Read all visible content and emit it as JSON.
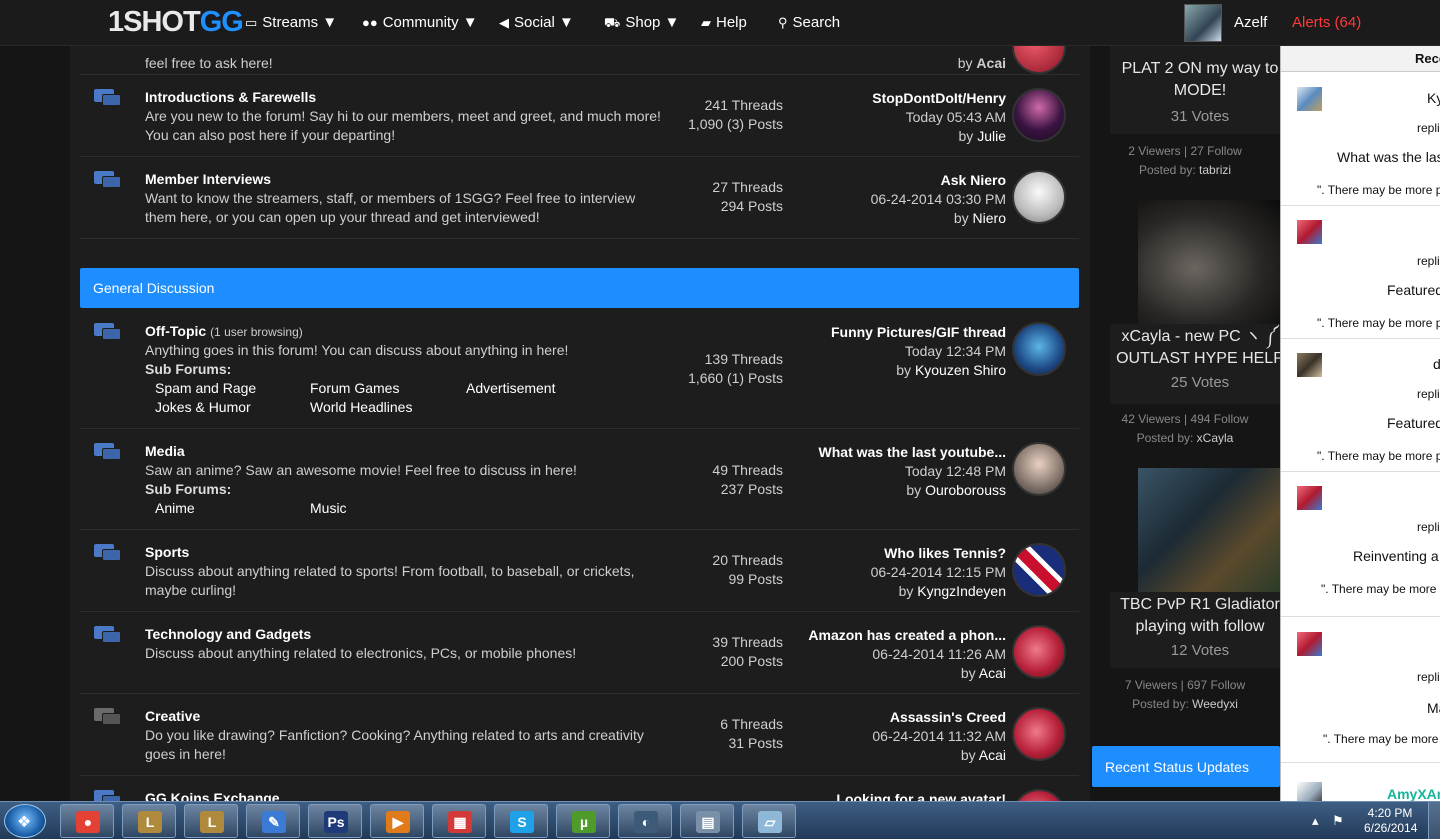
{
  "header": {
    "logo_part1": "1SHOT",
    "logo_part2": "GG",
    "nav": [
      {
        "icon": "monitor-icon",
        "label": "Streams ▼"
      },
      {
        "icon": "users-icon",
        "label": "Community ▼"
      },
      {
        "icon": "megaphone-icon",
        "label": "Social ▼"
      },
      {
        "icon": "cart-icon",
        "label": "Shop ▼"
      },
      {
        "icon": "book-icon",
        "label": "Help"
      },
      {
        "icon": "search-icon",
        "label": "Search"
      }
    ],
    "username": "Azelf",
    "alerts": "Alerts (64)"
  },
  "forums_top": [
    {
      "title": "",
      "desc": "feel free to ask here!",
      "last_by": "Acai"
    },
    {
      "title": "Introductions & Farewells",
      "desc": "Are you new to the forum! Say hi to our members, meet and greet, and much more! You can also post here if your departing!",
      "threads": "241 Threads",
      "posts": "1,090 (3) Posts",
      "last_title": "StopDontDoIt/Henry",
      "last_time": "Today 05:43 AM",
      "by_prefix": "by ",
      "last_by": "Julie"
    },
    {
      "title": "Member Interviews",
      "desc": "Want to know the streamers, staff, or members of 1SGG? Feel free to interview them here, or you can open up your thread and get interviewed!",
      "threads": "27 Threads",
      "posts": "294 Posts",
      "last_title": "Ask Niero",
      "last_time": "06-24-2014 03:30 PM",
      "by_prefix": "by ",
      "last_by": "Niero"
    }
  ],
  "category": "General Discussion",
  "forums": [
    {
      "title": "Off-Topic",
      "browsing": "(1 user browsing)",
      "desc": "Anything goes in this forum! You can discuss about anything in here!",
      "subforums_label": "Sub Forums:",
      "subforums": [
        "Spam and Rage",
        "Forum Games",
        "Advertisement",
        "Jokes & Humor",
        "World Headlines"
      ],
      "threads": "139 Threads",
      "posts": "1,660 (1) Posts",
      "last_title": "Funny Pictures/GIF thread",
      "last_time": "Today 12:34 PM",
      "by_prefix": "by ",
      "last_by": "Kyouzen Shiro"
    },
    {
      "title": "Media",
      "desc": "Saw an anime? Saw an awesome movie! Feel free to discuss in here!",
      "subforums_label": "Sub Forums:",
      "subforums": [
        "Anime",
        "Music"
      ],
      "threads": "49 Threads",
      "posts": "237 Posts",
      "last_title": "What was the last youtube...",
      "last_time": "Today 12:48 PM",
      "by_prefix": "by ",
      "last_by": "Ouroborouss"
    },
    {
      "title": "Sports",
      "desc": "Discuss about anything related to sports! From football, to baseball, or crickets, maybe curling!",
      "threads": "20 Threads",
      "posts": "99 Posts",
      "last_title": "Who likes Tennis?",
      "last_time": "06-24-2014 12:15 PM",
      "by_prefix": "by ",
      "last_by": "KyngzIndeyen"
    },
    {
      "title": "Technology and Gadgets",
      "desc": "Discuss about anything related to electronics, PCs, or mobile phones!",
      "threads": "39 Threads",
      "posts": "200 Posts",
      "last_title": "Amazon has created a phon...",
      "last_time": "06-24-2014 11:26 AM",
      "by_prefix": "by ",
      "last_by": "Acai"
    },
    {
      "title": "Creative",
      "desc": "Do you like drawing? Fanfiction? Cooking? Anything related to arts and creativity goes in here!",
      "threads": "6 Threads",
      "posts": "31 Posts",
      "last_title": "Assassin's Creed",
      "last_time": "06-24-2014 11:32 AM",
      "by_prefix": "by ",
      "last_by": "Acai"
    },
    {
      "title": "GG Koins Exchange",
      "last_title": "Looking for a new avatar!"
    }
  ],
  "streams": [
    {
      "title": "PLAT 2 ON my way to MODE!",
      "votes": "31 Votes",
      "meta": "2 Viewers | 27 Follow",
      "posted_by_label": "Posted by: ",
      "posted_by": "tabrizi"
    },
    {
      "title": "xCayla - new PC ヽ ༼ OUTLAST HYPE HELP ",
      "votes": "25 Votes",
      "meta": "42 Viewers | 494 Follow",
      "posted_by_label": "Posted by: ",
      "posted_by": "xCayla"
    },
    {
      "title": "TBC PvP R1 Gladiator playing with follow",
      "votes": "12 Votes",
      "meta": "7 Viewers | 697 Follow",
      "posted_by_label": "Posted by: ",
      "posted_by": "Weedyxi"
    }
  ],
  "recent_status": "Recent Status Updates",
  "alerts_panel": {
    "header": "Rece",
    "items": [
      {
        "name": "Ky",
        "action": "replie",
        "thread": "What was the las",
        "more": "\". There may be more pos"
      },
      {
        "name": "",
        "action": "replie",
        "thread": "Featured S",
        "more": "\". There may be more pos"
      },
      {
        "name": "d",
        "action": "replie",
        "thread": "Featured S",
        "more": "\". There may be more pos"
      },
      {
        "name": "",
        "action": "replie",
        "thread": "Reinventing a",
        "more": "\". There may be more pos"
      },
      {
        "name": "",
        "action": "replie",
        "thread": "Ma",
        "more": "\". There may be more pos"
      },
      {
        "name": "AmyXAn",
        "action": "",
        "thread": "",
        "more": ""
      }
    ]
  },
  "taskbar": {
    "time": "4:20 PM",
    "date": "6/26/2014",
    "apps": [
      {
        "icon": "chrome-icon",
        "glyph": "●",
        "color": "#e34133"
      },
      {
        "icon": "league-icon",
        "glyph": "L",
        "color": "#b08a3c"
      },
      {
        "icon": "league-icon",
        "glyph": "L",
        "color": "#b08a3c"
      },
      {
        "icon": "pen-icon",
        "glyph": "✎",
        "color": "#3b7bd6"
      },
      {
        "icon": "photoshop-icon",
        "glyph": "Ps",
        "color": "#1e3a78"
      },
      {
        "icon": "media-player-icon",
        "glyph": "▶",
        "color": "#e07b1c"
      },
      {
        "icon": "apps-grid-icon",
        "glyph": "▦",
        "color": "#d23a3a"
      },
      {
        "icon": "skype-icon",
        "glyph": "S",
        "color": "#1ea1e8"
      },
      {
        "icon": "utorrent-icon",
        "glyph": "µ",
        "color": "#4e9a2a"
      },
      {
        "icon": "steam-icon",
        "glyph": "◐",
        "color": "#3d5a78"
      },
      {
        "icon": "calculator-icon",
        "glyph": "▤",
        "color": "#7a8fa8"
      },
      {
        "icon": "notes-icon",
        "glyph": "▱",
        "color": "#8fb8d8"
      }
    ]
  }
}
